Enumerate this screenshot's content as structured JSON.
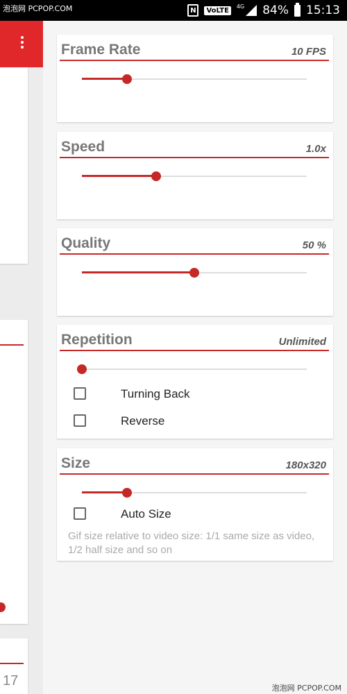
{
  "status_bar": {
    "watermark": "泡泡网 PCPOP.COM",
    "nfc": "N",
    "volte": "VoLTE",
    "network": "4G",
    "battery_percent": "84%",
    "time": "15:13"
  },
  "background": {
    "page_number": "17"
  },
  "settings": {
    "frame_rate": {
      "title": "Frame Rate",
      "value": "10 FPS",
      "slider_fraction": 0.2
    },
    "speed": {
      "title": "Speed",
      "value": "1.0x",
      "slider_fraction": 0.33
    },
    "quality": {
      "title": "Quality",
      "value": "50 %",
      "slider_fraction": 0.5
    },
    "repetition": {
      "title": "Repetition",
      "value": "Unlimited",
      "slider_fraction": 0.0,
      "options": [
        {
          "label": "Turning Back",
          "checked": false
        },
        {
          "label": "Reverse",
          "checked": false
        }
      ]
    },
    "size": {
      "title": "Size",
      "value": "180x320",
      "slider_fraction": 0.2,
      "auto_size": {
        "label": "Auto Size",
        "checked": false
      },
      "hint": "Gif size relative to video size: 1/1 same size as video, 1/2 half size and so on"
    }
  },
  "colors": {
    "accent": "#c62828",
    "toolbar": "#e0282b"
  },
  "watermark_bottom": "泡泡网 PCPOP.COM"
}
